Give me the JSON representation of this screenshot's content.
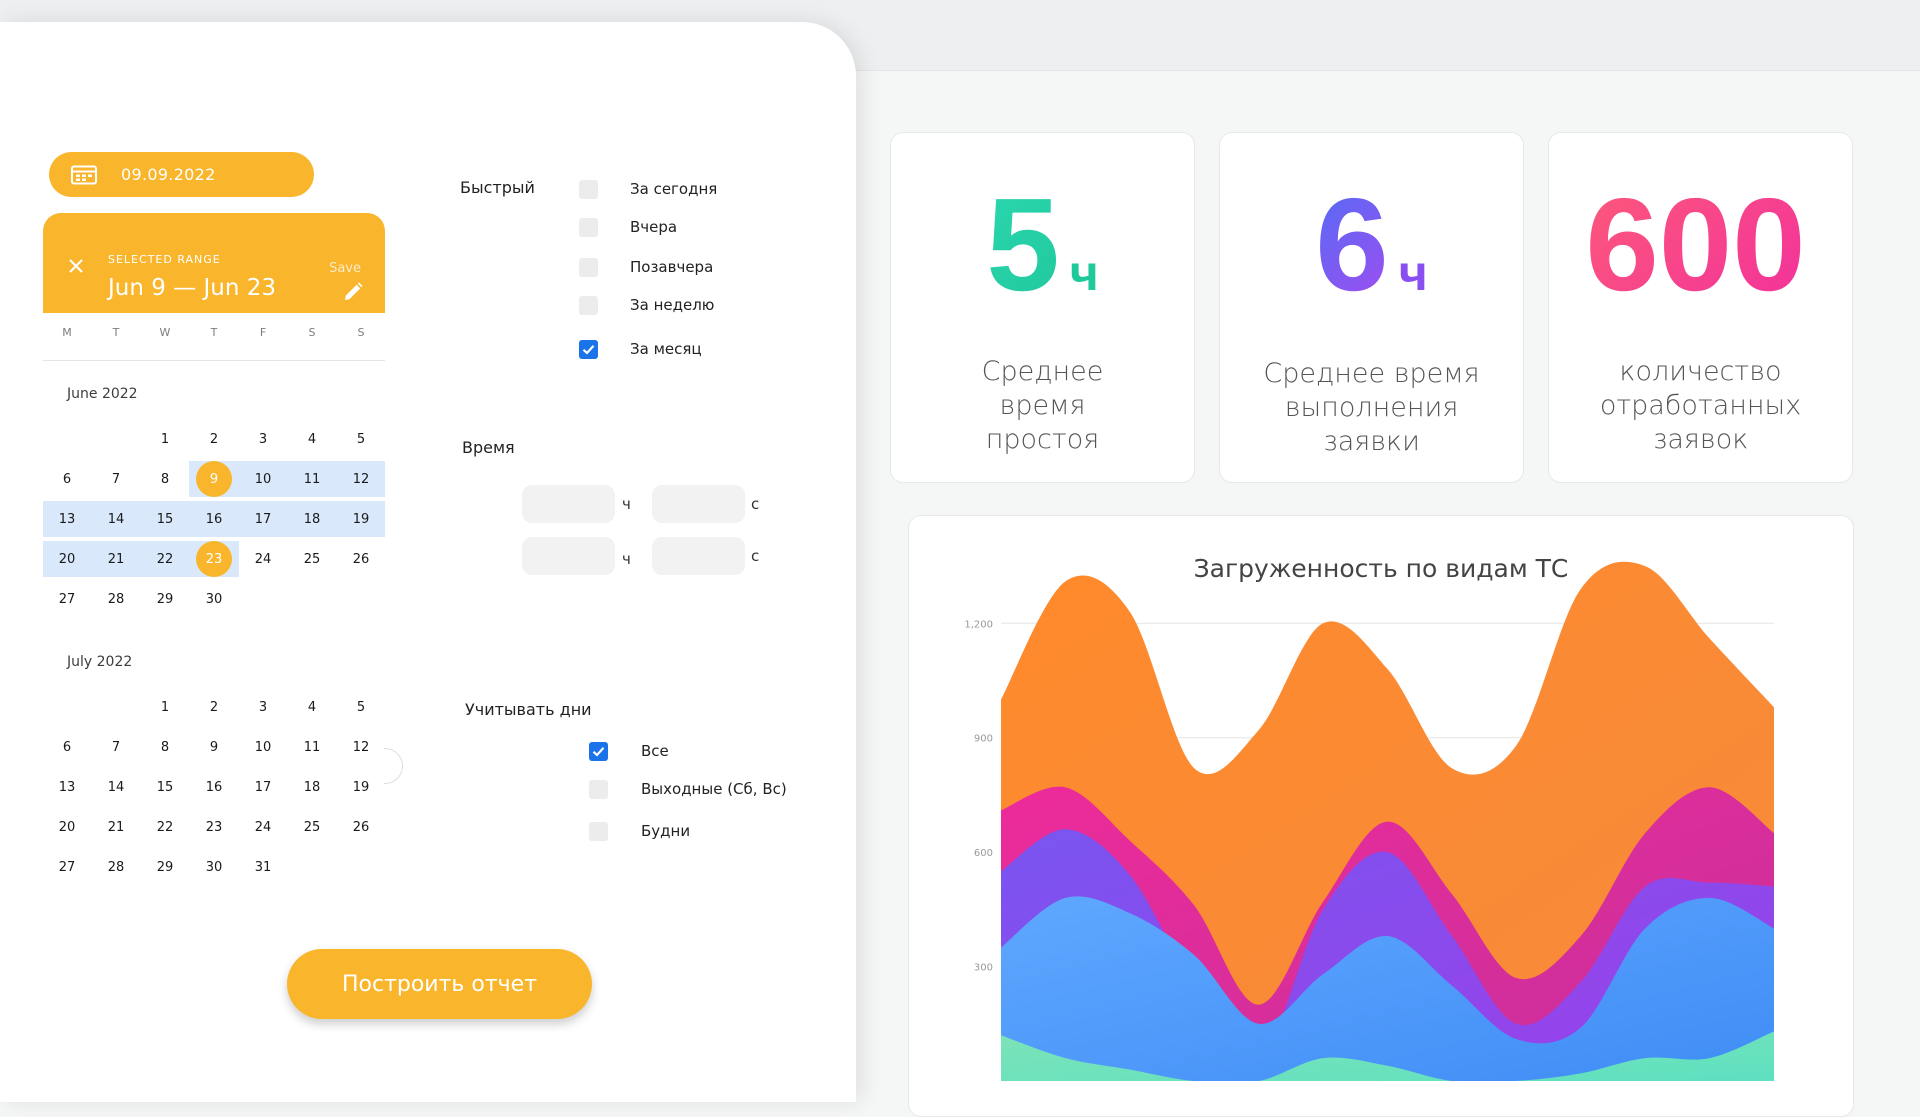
{
  "date_pill": {
    "value": "09.09.2022"
  },
  "range_picker": {
    "selected_range_label": "SELECTED RANGE",
    "range_text": "Jun 9 — Jun 23",
    "save_label": "Save",
    "weekdays": [
      "M",
      "T",
      "W",
      "T",
      "F",
      "S",
      "S"
    ],
    "months": [
      {
        "label": "June 2022",
        "first_offset": 2,
        "days": 30,
        "range_start": 9,
        "range_end": 23
      },
      {
        "label": "July 2022",
        "first_offset": 2,
        "days": 31,
        "range_start": null,
        "range_end": null
      }
    ]
  },
  "quick": {
    "title": "Быстрый",
    "options": [
      {
        "label": "За сегодня",
        "checked": false
      },
      {
        "label": "Вчера",
        "checked": false
      },
      {
        "label": "Позавчера",
        "checked": false
      },
      {
        "label": "За неделю",
        "checked": false
      },
      {
        "label": "За месяц",
        "checked": true
      }
    ]
  },
  "time": {
    "title": "Время",
    "hours_unit": "ч",
    "seconds_unit": "с",
    "rows": [
      {
        "hours": "",
        "seconds": ""
      },
      {
        "hours": "",
        "seconds": ""
      }
    ]
  },
  "days_filter": {
    "title": "Учитывать дни",
    "options": [
      {
        "label": "Все",
        "checked": true
      },
      {
        "label": "Выходные (Сб, Вс)",
        "checked": false
      },
      {
        "label": "Будни",
        "checked": false
      }
    ]
  },
  "build_button": {
    "label": "Построить отчет"
  },
  "kpis": [
    {
      "value": "5",
      "unit": "ч",
      "caption": [
        "Среднее",
        "время",
        "простоя"
      ],
      "colors": [
        "#2bd8b0",
        "#21c79b"
      ],
      "unit_color": "#1fc99a"
    },
    {
      "value": "6",
      "unit": "ч",
      "caption": [
        "Среднее время",
        "выполнения",
        "заявки"
      ],
      "colors": [
        "#4f6ef5",
        "#a44bf0"
      ],
      "unit_color": "#8a4ff0"
    },
    {
      "value": "600",
      "unit": "",
      "caption": [
        "количество",
        "отработанных",
        "заявок"
      ],
      "colors": [
        "#fd5a7a",
        "#f2309c"
      ],
      "unit_color": "#f2309c"
    }
  ],
  "chart_data": {
    "type": "area",
    "title": "Загруженность по видам ТС",
    "y_ticks": [
      300,
      600,
      900,
      1200
    ],
    "ylim": [
      0,
      1400
    ],
    "grid": true,
    "legend": "none",
    "x": [
      0,
      1,
      2,
      3,
      4,
      5,
      6,
      7,
      8,
      9,
      10,
      11,
      12
    ],
    "series": [
      {
        "colors": [
          "#7de3b8",
          "#5ee0c0"
        ],
        "values": [
          120,
          60,
          30,
          0,
          0,
          60,
          40,
          0,
          0,
          20,
          60,
          60,
          130
        ]
      },
      {
        "colors": [
          "#5fa8ff",
          "#3f8cf5"
        ],
        "values": [
          350,
          480,
          440,
          330,
          150,
          280,
          380,
          250,
          110,
          140,
          400,
          480,
          400
        ]
      },
      {
        "colors": [
          "#7a55f0",
          "#9b3fe8"
        ],
        "values": [
          550,
          660,
          540,
          250,
          60,
          450,
          600,
          380,
          150,
          260,
          510,
          520,
          510
        ]
      },
      {
        "colors": [
          "#ed2b9a",
          "#c6309c"
        ],
        "values": [
          710,
          770,
          630,
          460,
          200,
          470,
          680,
          490,
          270,
          380,
          650,
          770,
          650
        ]
      },
      {
        "colors": [
          "#ff8a2b",
          "#f58a3d"
        ],
        "values": [
          1000,
          1310,
          1230,
          820,
          920,
          1200,
          1080,
          820,
          880,
          1290,
          1350,
          1160,
          980
        ]
      }
    ]
  }
}
